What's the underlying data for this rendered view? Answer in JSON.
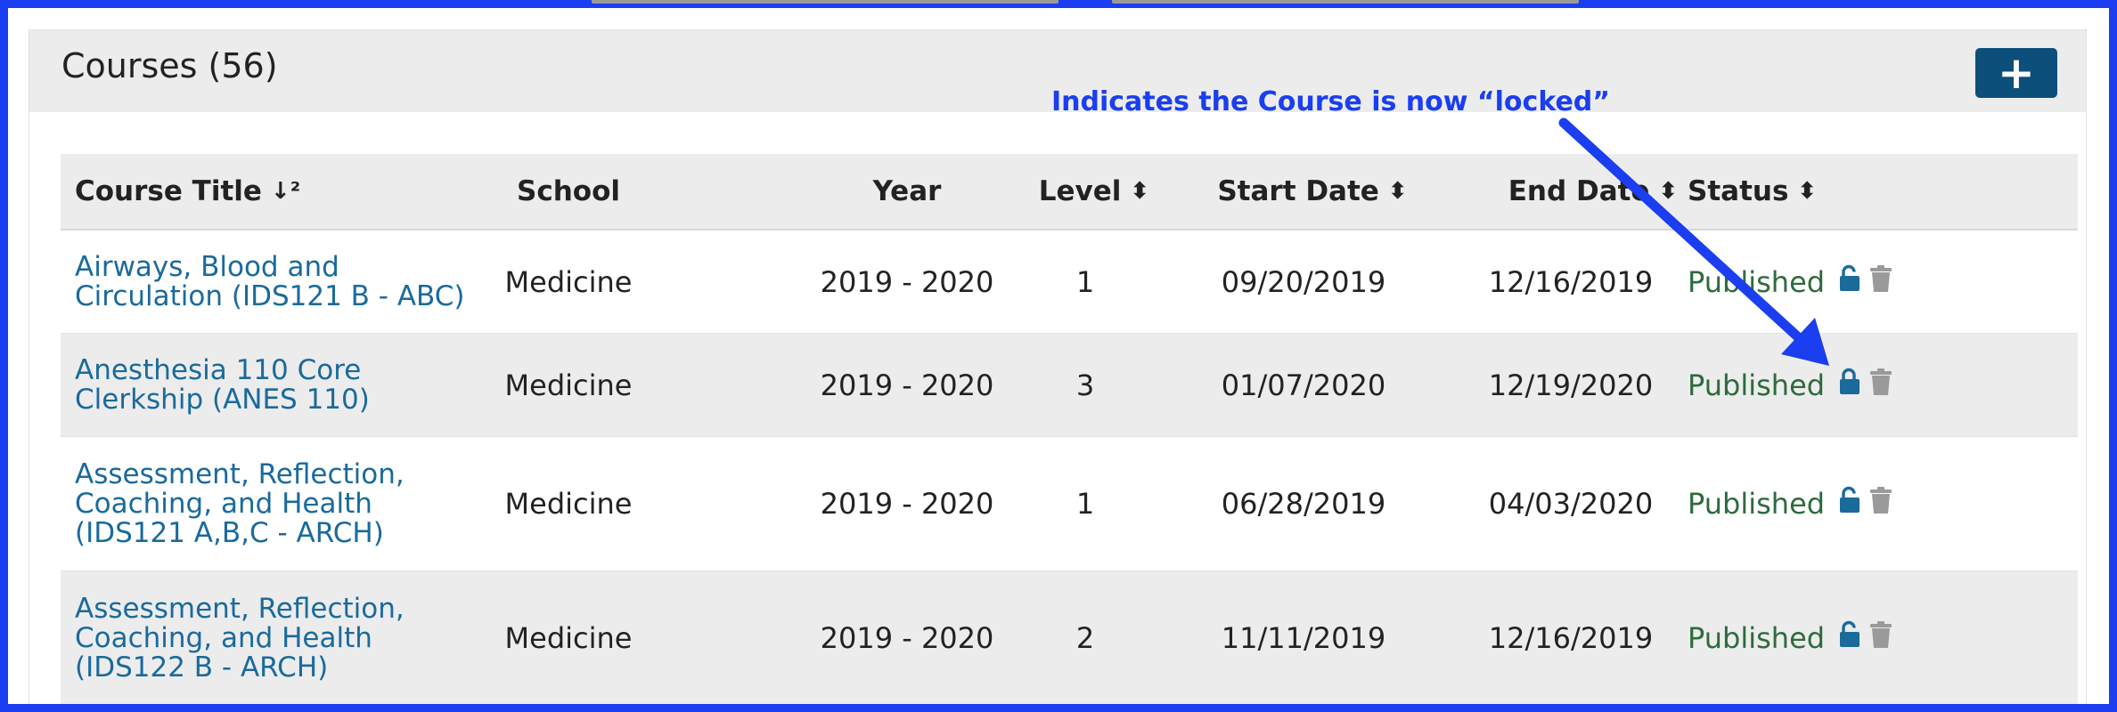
{
  "panel": {
    "title": "Courses (56)",
    "add_label": "+"
  },
  "annotation": {
    "text": "Indicates the Course is now “locked”"
  },
  "table": {
    "headers": {
      "title": "Course Title",
      "school": "School",
      "year": "Year",
      "level": "Level",
      "start": "Start Date",
      "end": "End Date",
      "status": "Status"
    },
    "sort_icons": {
      "title": "↓²",
      "level": "⬍",
      "start": "⬍",
      "end": "⬍",
      "status": "⬍"
    },
    "rows": [
      {
        "title_line1": "Airways, Blood and",
        "title_line2": "Circulation (IDS121 B - ABC)",
        "title_line3": "",
        "school": "Medicine",
        "year": "2019 - 2020",
        "level": "1",
        "start": "09/20/2019",
        "end": "12/16/2019",
        "status": "Published",
        "lock": "unlocked-icon"
      },
      {
        "title_line1": "Anesthesia 110 Core",
        "title_line2": "Clerkship (ANES 110)",
        "title_line3": "",
        "school": "Medicine",
        "year": "2019 - 2020",
        "level": "3",
        "start": "01/07/2020",
        "end": "12/19/2020",
        "status": "Published",
        "lock": "locked-icon"
      },
      {
        "title_line1": "Assessment, Reflection,",
        "title_line2": "Coaching, and Health",
        "title_line3": "(IDS121 A,B,C - ARCH)",
        "school": "Medicine",
        "year": "2019 - 2020",
        "level": "1",
        "start": "06/28/2019",
        "end": "04/03/2020",
        "status": "Published",
        "lock": "unlocked-icon"
      },
      {
        "title_line1": "Assessment, Reflection,",
        "title_line2": "Coaching, and Health",
        "title_line3": "(IDS122 B - ARCH)",
        "school": "Medicine",
        "year": "2019 - 2020",
        "level": "2",
        "start": "11/11/2019",
        "end": "12/16/2019",
        "status": "Published",
        "lock": "unlocked-icon"
      }
    ]
  },
  "colors": {
    "accent": "#1a3ef0",
    "link": "#1a6a9c",
    "status_published": "#2d6b3d",
    "lock": "#1a6a9c",
    "trash": "#9a9a9a",
    "button_bg": "#0b4f7a"
  }
}
